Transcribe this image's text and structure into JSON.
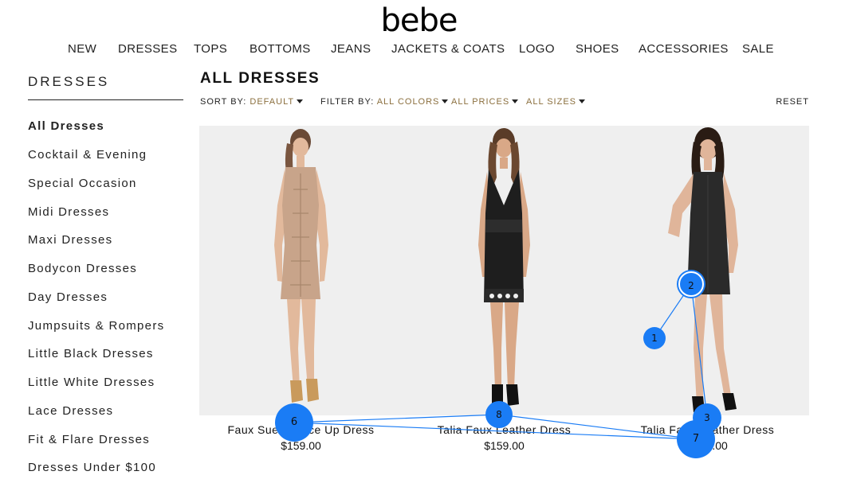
{
  "brand": {
    "logo_text": "bebe"
  },
  "topnav": [
    "NEW",
    "DRESSES",
    "TOPS",
    "BOTTOMS",
    "JEANS",
    "JACKETS & COATS",
    "LOGO",
    "SHOES",
    "ACCESSORIES",
    "SALE"
  ],
  "sidebar": {
    "title": "DRESSES",
    "items": [
      {
        "label": "All Dresses",
        "active": true
      },
      {
        "label": "Cocktail & Evening"
      },
      {
        "label": "Special Occasion"
      },
      {
        "label": "Midi Dresses"
      },
      {
        "label": "Maxi Dresses"
      },
      {
        "label": "Bodycon Dresses"
      },
      {
        "label": "Day Dresses"
      },
      {
        "label": "Jumpsuits & Rompers"
      },
      {
        "label": "Little Black Dresses"
      },
      {
        "label": "Little White Dresses"
      },
      {
        "label": "Lace Dresses"
      },
      {
        "label": "Fit & Flare Dresses"
      },
      {
        "label": "Dresses Under $100"
      }
    ]
  },
  "main": {
    "title": "ALL DRESSES",
    "sort_label": "SORT BY:",
    "sort_value": "DEFAULT",
    "filter_label": "FILTER BY:",
    "filter_colors": "ALL COLORS",
    "filter_prices": "ALL PRICES",
    "filter_sizes": "ALL SIZES",
    "reset_label": "RESET"
  },
  "products": [
    {
      "name": "Faux Suede Lace Up Dress",
      "price": "$159.00",
      "dress_color": "#c8a48a"
    },
    {
      "name": "Talia Faux Leather Dress",
      "price": "$159.00",
      "dress_color": "#1e1e1e"
    },
    {
      "name": "Talia Faux Leather Dress",
      "price": "$159.00",
      "dress_color": "#2a2a2a"
    }
  ],
  "markers": [
    {
      "label": "1"
    },
    {
      "label": "2"
    },
    {
      "label": "3"
    },
    {
      "label": "6"
    },
    {
      "label": "7"
    },
    {
      "label": "8"
    }
  ],
  "colors": {
    "accent": "#8b6f3e",
    "marker": "#1a7cf5",
    "grid_bg": "#eeeeef"
  }
}
